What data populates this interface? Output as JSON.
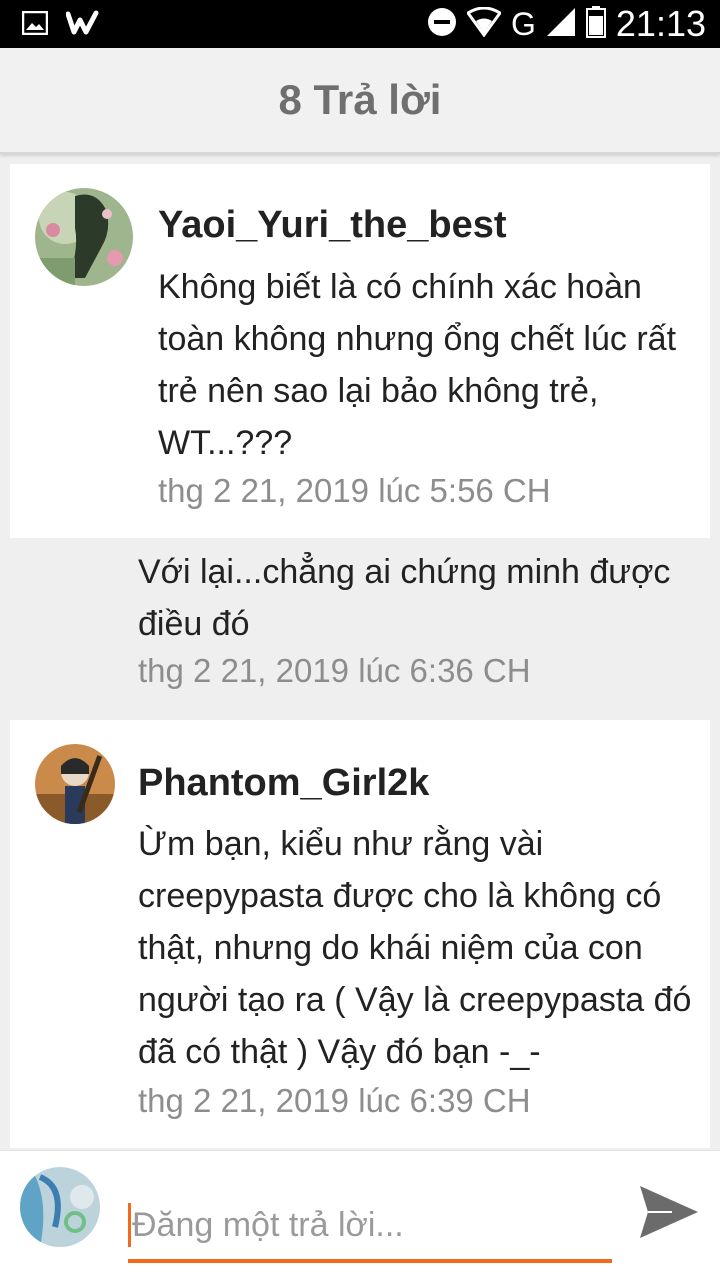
{
  "status_bar": {
    "time": "21:13",
    "network": "G",
    "icons": [
      "gallery-icon",
      "wattpad-icon",
      "do-not-disturb-icon",
      "wifi-icon",
      "signal-icon",
      "battery-icon"
    ]
  },
  "header": {
    "title": "8 Trả lời"
  },
  "comments": [
    {
      "username": "Yaoi_Yuri_the_best",
      "text": "Không biết là có chính xác hoàn toàn không nhưng ổng chết lúc rất trẻ nên sao lại bảo không trẻ, WT...???",
      "time": "thg 2 21, 2019 lúc 5:56 CH"
    },
    {
      "text": "Với lại...chẳng ai chứng minh được điều đó",
      "time": "thg 2 21, 2019 lúc 6:36 CH"
    },
    {
      "username": "Phantom_Girl2k",
      "text": "Ừm bạn, kiểu như rằng vài creepypasta được cho là không có thật, nhưng do khái niệm của con người tạo ra ( Vậy là creepypasta đó đã có thật )  Vậy đó bạn -_-",
      "time": "thg 2 21, 2019 lúc 6:39 CH"
    }
  ],
  "composer": {
    "placeholder": "Đăng một trả lời..."
  },
  "colors": {
    "accent": "#f26a1b",
    "background": "#efefef",
    "timestamp": "#8d8d8d"
  }
}
